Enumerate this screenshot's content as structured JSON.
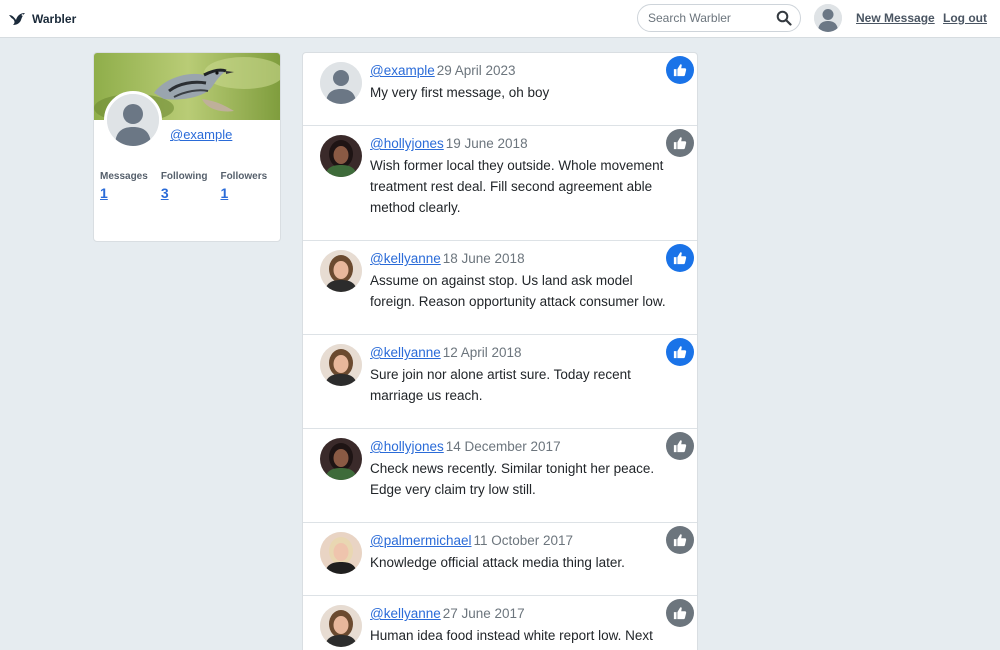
{
  "navbar": {
    "brand": "Warbler",
    "search_placeholder": "Search Warbler",
    "new_message": "New Message",
    "logout": "Log out"
  },
  "profile": {
    "username": "@example",
    "stats": [
      {
        "label": "Messages",
        "value": "1"
      },
      {
        "label": "Following",
        "value": "3"
      },
      {
        "label": "Followers",
        "value": "1"
      }
    ]
  },
  "messages": [
    {
      "user": "@example",
      "date": "29 April 2023",
      "text": "My very first message, oh boy",
      "liked": true,
      "avatar": "default-avatar"
    },
    {
      "user": "@hollyjones",
      "date": "19 June 2018",
      "text": "Wish former local they outside. Whole movement treatment rest deal. Fill second agreement able method clearly.",
      "liked": false,
      "avatar": "photo-avatar"
    },
    {
      "user": "@kellyanne",
      "date": "18 June 2018",
      "text": "Assume on against stop. Us land ask model foreign. Reason opportunity attack consumer low.",
      "liked": true,
      "avatar": "photo-avatar"
    },
    {
      "user": "@kellyanne",
      "date": "12 April 2018",
      "text": "Sure join nor alone artist sure. Today recent marriage us reach.",
      "liked": true,
      "avatar": "photo-avatar"
    },
    {
      "user": "@hollyjones",
      "date": "14 December 2017",
      "text": "Check news recently. Similar tonight her peace. Edge very claim try low still.",
      "liked": false,
      "avatar": "photo-avatar"
    },
    {
      "user": "@palmermichael",
      "date": "11 October 2017",
      "text": "Knowledge official attack media thing later.",
      "liked": false,
      "avatar": "photo-avatar"
    },
    {
      "user": "@kellyanne",
      "date": "27 June 2017",
      "text": "Human idea food instead white report low. Next",
      "liked": false,
      "avatar": "photo-avatar"
    }
  ],
  "colors": {
    "liked": "#1a73e8",
    "unliked": "#6c757d",
    "link": "#2a6bd8",
    "background": "#e6ecf0"
  }
}
